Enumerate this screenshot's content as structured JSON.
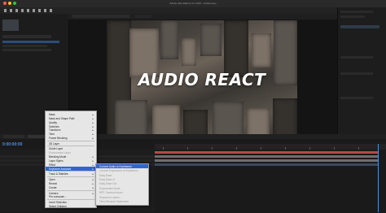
{
  "app": {
    "title": "Adobe After Effects CC 2018 - Untitled.aep",
    "colors": {
      "accent": "#4d8fe0",
      "menu_highlight": "#2f66d0",
      "track_red": "#b34b4b",
      "track_gray": "#6e6e6e"
    }
  },
  "viewer": {
    "title": "AUDIO REACT"
  },
  "timeline": {
    "timecode": "0:00:00:00"
  },
  "context_menu": {
    "items": [
      {
        "label": "Mask",
        "arrow": true,
        "disabled": false
      },
      {
        "label": "Mask and Shape Path",
        "arrow": true,
        "disabled": false
      },
      {
        "label": "Quality",
        "arrow": true,
        "disabled": false
      },
      {
        "label": "Switches",
        "arrow": true,
        "disabled": false
      },
      {
        "label": "Transform",
        "arrow": true,
        "disabled": false
      },
      {
        "label": "Time",
        "arrow": true,
        "disabled": false
      },
      {
        "label": "Frame Blending",
        "arrow": true,
        "disabled": false
      },
      {
        "label": "3D Layer",
        "arrow": false,
        "disabled": false
      },
      {
        "label": "Guide Layer",
        "arrow": false,
        "disabled": false
      },
      {
        "label": "Environment Layer",
        "arrow": false,
        "disabled": true
      },
      {
        "label": "Blending Mode",
        "arrow": true,
        "disabled": false
      },
      {
        "label": "Layer Styles",
        "arrow": true,
        "disabled": false
      },
      {
        "label": "Effect",
        "arrow": true,
        "disabled": false
      },
      {
        "label": "Keyframe Assistant",
        "arrow": true,
        "disabled": false,
        "highlighted": true
      },
      {
        "label": "Track & Stabilize",
        "arrow": true,
        "disabled": false
      },
      {
        "label": "Open",
        "arrow": true,
        "disabled": false
      },
      {
        "label": "Reveal",
        "arrow": true,
        "disabled": false
      },
      {
        "label": "Create",
        "arrow": true,
        "disabled": false
      },
      {
        "label": "Camera",
        "arrow": true,
        "disabled": false
      },
      {
        "label": "Pre-compose...",
        "arrow": false,
        "disabled": false
      },
      {
        "label": "Invert Selection",
        "arrow": false,
        "disabled": false
      },
      {
        "label": "Select Children",
        "arrow": false,
        "disabled": false
      },
      {
        "label": "Rename",
        "arrow": false,
        "disabled": false
      }
    ]
  },
  "submenu": {
    "items": [
      {
        "label": "Convert Audio to Keyframes",
        "enabled": true
      },
      {
        "label": "Convert Expression to Keyframes",
        "enabled": false
      },
      {
        "label": "Easy Ease",
        "enabled": false
      },
      {
        "label": "Easy Ease In",
        "enabled": false
      },
      {
        "label": "Easy Ease Out",
        "enabled": false
      },
      {
        "label": "Exponential Scale",
        "enabled": false
      },
      {
        "label": "RPF Camera Import",
        "enabled": false
      },
      {
        "label": "Sequence Layers...",
        "enabled": false
      },
      {
        "label": "Time-Reverse Keyframes",
        "enabled": false
      }
    ]
  }
}
